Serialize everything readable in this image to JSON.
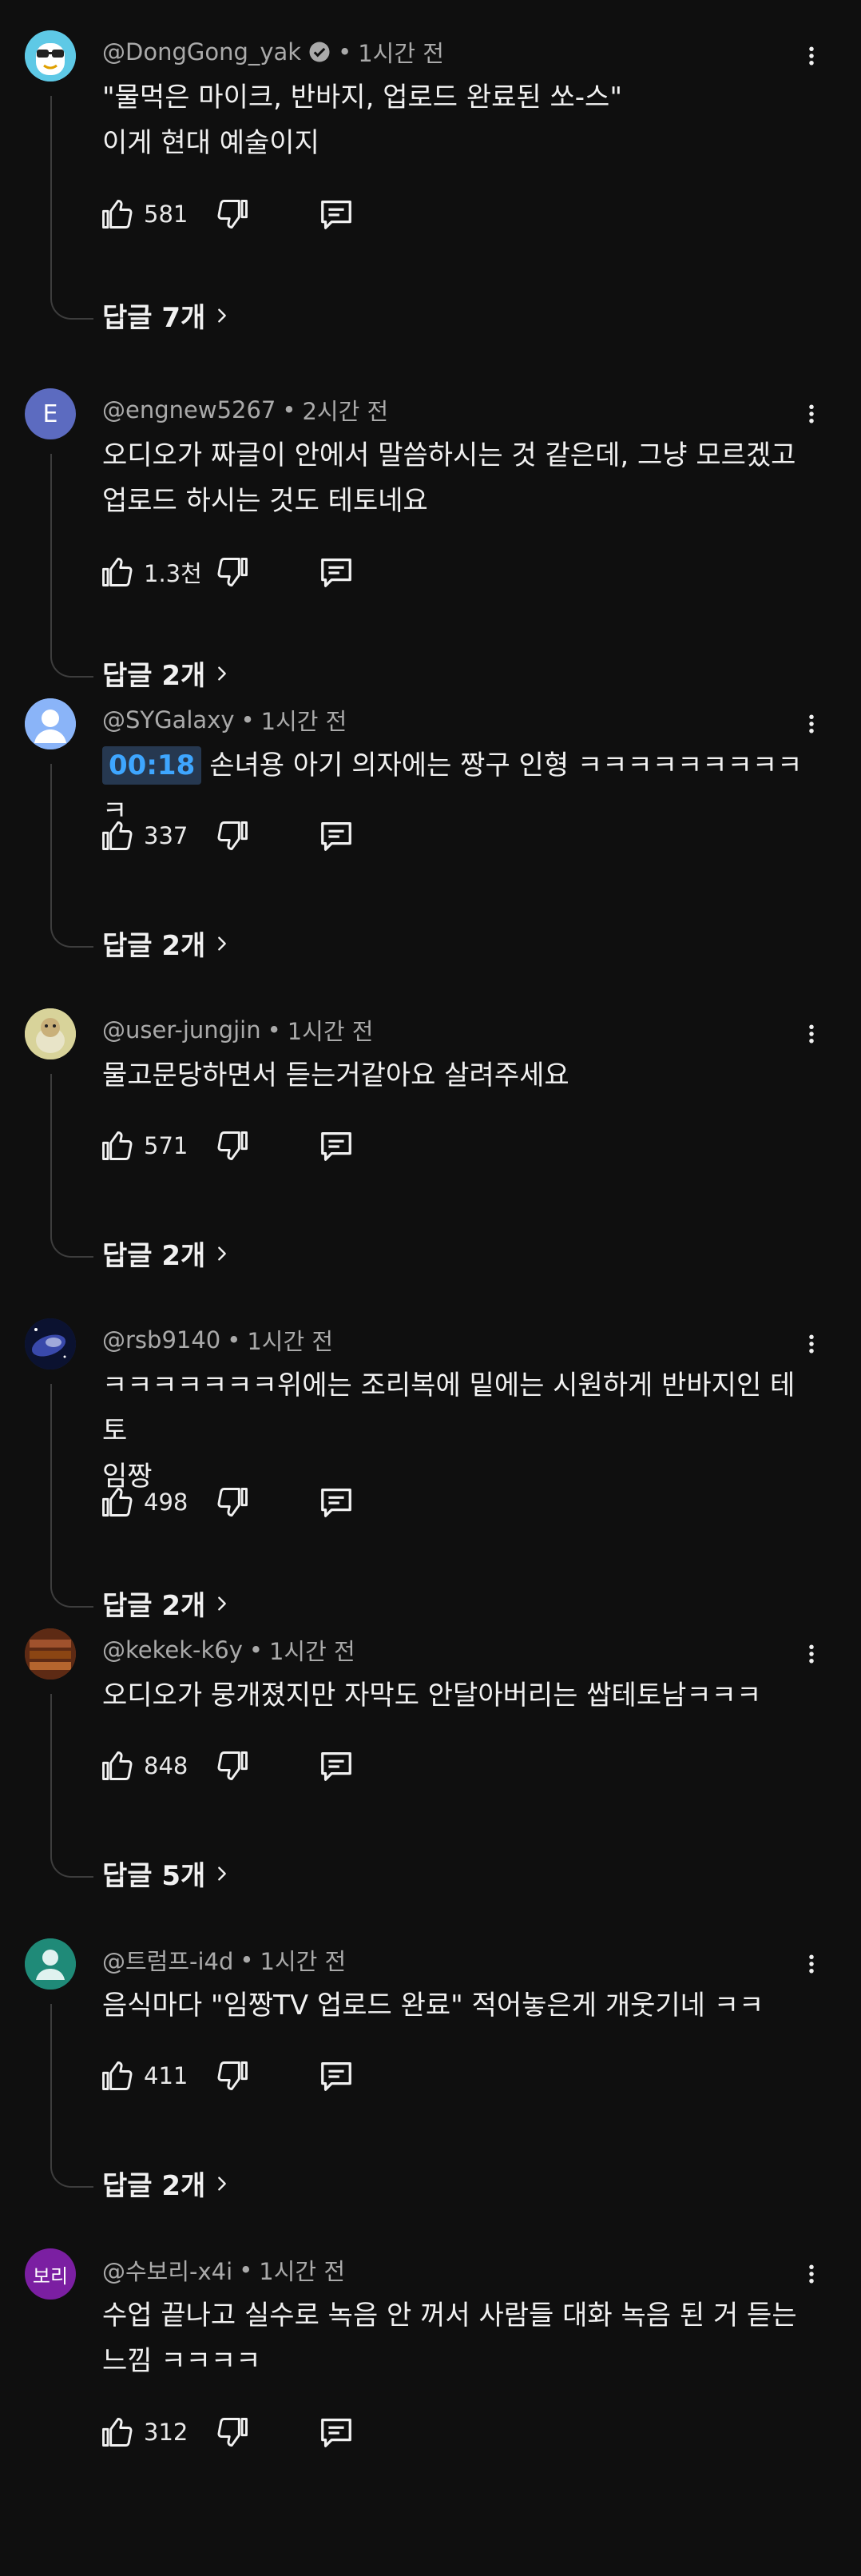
{
  "comments": [
    {
      "handle": "@DongGong_yak",
      "verified": true,
      "time": "1시간 전",
      "lines": [
        "\"물먹은 마이크, 반바지, 업로드 완료된 쏘-스\"",
        "이게 현대 예술이지"
      ],
      "timestamp": "",
      "likes": "581",
      "replies": "답글 7개",
      "avatar_text": "",
      "avatar_color": "#5ec9e6"
    },
    {
      "handle": "@engnew5267",
      "verified": false,
      "time": "2시간 전",
      "lines": [
        "오디오가 짜글이 안에서 말씀하시는 것 같은데, 그냥 모르겠고",
        "업로드 하시는 것도 테토네요"
      ],
      "timestamp": "",
      "likes": "1.3천",
      "replies": "답글 2개",
      "avatar_text": "E",
      "avatar_color": "#5c6bc0"
    },
    {
      "handle": "@SYGalaxy",
      "verified": false,
      "time": "1시간 전",
      "lines": [
        "손녀용 아기 의자에는 짱구 인형 ㅋㅋㅋㅋㅋㅋㅋㅋㅋㅋ"
      ],
      "timestamp": "00:18",
      "likes": "337",
      "replies": "답글 2개",
      "avatar_text": "",
      "avatar_color": "#8ab4f8"
    },
    {
      "handle": "@user-jungjin",
      "verified": false,
      "time": "1시간 전",
      "lines": [
        "물고문당하면서 듣는거같아요 살려주세요"
      ],
      "timestamp": "",
      "likes": "571",
      "replies": "답글 2개",
      "avatar_text": "",
      "avatar_color": "#c9c97a"
    },
    {
      "handle": "@rsb9140",
      "verified": false,
      "time": "1시간 전",
      "lines": [
        "ㅋㅋㅋㅋㅋㅋㅋ위에는 조리복에 밑에는 시원하게 반바지인 테토",
        "임짱"
      ],
      "timestamp": "",
      "likes": "498",
      "replies": "답글 2개",
      "avatar_text": "",
      "avatar_color": "#1a2a5e"
    },
    {
      "handle": "@kekek-k6y",
      "verified": false,
      "time": "1시간 전",
      "lines": [
        "오디오가 뭉개졌지만 자막도 안달아버리는 쌉테토남ㅋㅋㅋ"
      ],
      "timestamp": "",
      "likes": "848",
      "replies": "답글 5개",
      "avatar_text": "",
      "avatar_color": "#7a3b22"
    },
    {
      "handle": "@트럼프-i4d",
      "verified": false,
      "time": "1시간 전",
      "lines": [
        "음식마다 \"임짱TV 업로드 완료\" 적어놓은게 개웃기네 ㅋㅋ"
      ],
      "timestamp": "",
      "likes": "411",
      "replies": "답글 2개",
      "avatar_text": "",
      "avatar_color": "#1f8a78"
    },
    {
      "handle": "@수보리-x4i",
      "verified": false,
      "time": "1시간 전",
      "lines": [
        "수업 끝나고 실수로 녹음 안 꺼서 사람들 대화 녹음 된 거 듣는",
        "느낌 ㅋㅋㅋㅋ"
      ],
      "timestamp": "",
      "likes": "312",
      "replies": "",
      "avatar_text": "보리",
      "avatar_color": "#7b1fa2"
    }
  ]
}
